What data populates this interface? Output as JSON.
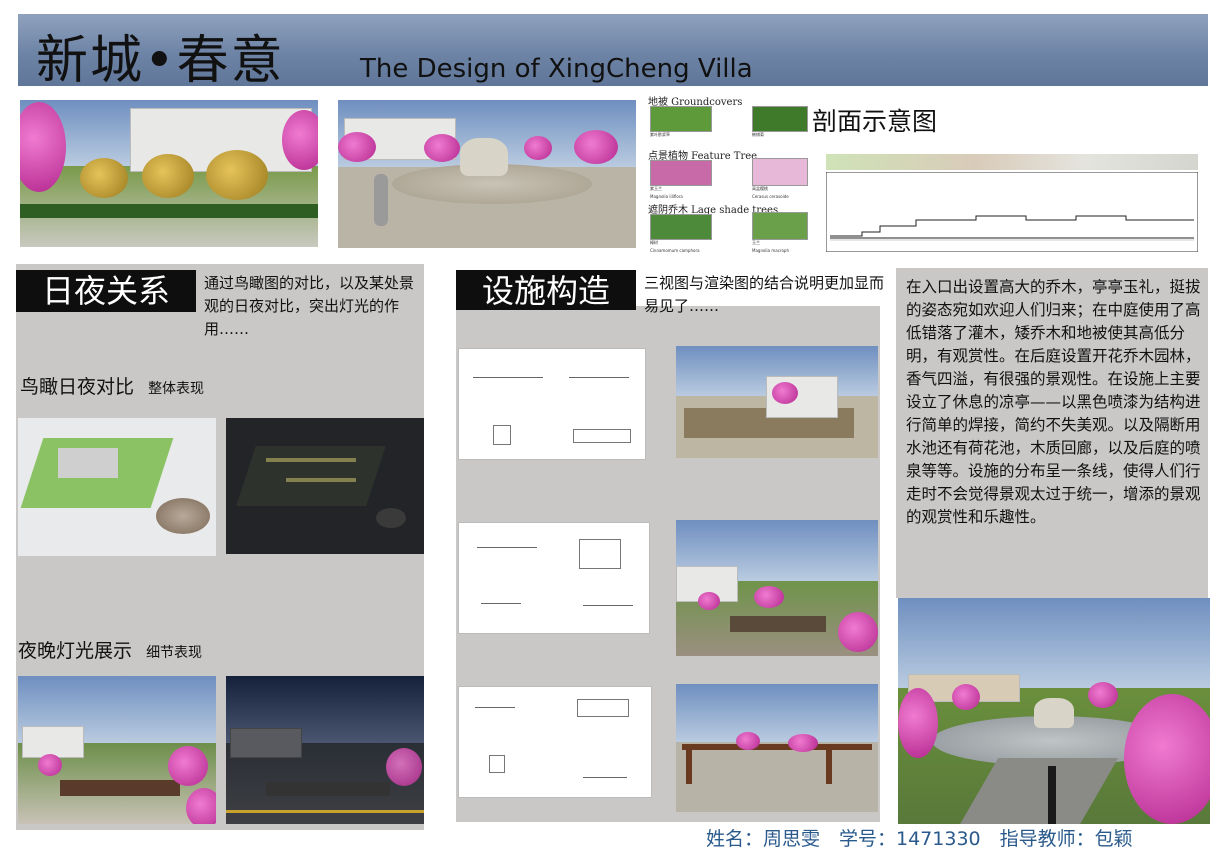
{
  "header": {
    "title_cn": "新城•春意",
    "title_en": "The Design of XingCheng Villa"
  },
  "plants": {
    "groundcovers_title": "地被 Groundcovers",
    "groundcover_1": "紫叶酢浆草",
    "groundcover_2": "蟛蜞菊",
    "feature_tree_title": "点景植物 Feature Tree",
    "feature_1_cn": "紫玉兰",
    "feature_1_en": "Magnolia liliflora",
    "feature_2_cn": "高盆樱桃",
    "feature_2_en": "Cerasus cerasoide",
    "shade_title": "遮阴乔木 Lage shade trees",
    "shade_1_cn": "樟树",
    "shade_1_en": "Cinnamomum camphora",
    "shade_2_cn": "玉兰",
    "shade_2_en": "Magnolia macroph"
  },
  "section": {
    "title": "剖面示意图"
  },
  "day_night": {
    "tag": "日夜关系",
    "desc": "通过鸟瞰图的对比，以及某处景观的日夜对比，突出灯光的作用……",
    "aerial_heading": "鸟瞰日夜对比",
    "aerial_sub": "整体表现",
    "night_heading": "夜晚灯光展示",
    "night_sub": "细节表现"
  },
  "facilities": {
    "tag": "设施构造",
    "desc": "三视图与渲染图的结合说明更加显而易见了……"
  },
  "body_text": "在入口出设置高大的乔木，亭亭玉礼，挺拔的姿态宛如欢迎人们归来；在中庭使用了高低错落了灌木，矮乔木和地被使其高低分明，有观赏性。在后庭设置开花乔木园林，香气四溢，有很强的景观性。在设施上主要设立了休息的凉亭——以黑色喷漆为结构进行简单的焊接，简约不失美观。以及隔断用水池还有荷花池，木质回廊，以及后庭的喷泉等等。设施的分布呈一条线，使得人们行走时不会觉得景观太过于统一，增添的景观的观赏性和乐趣性。",
  "footer": "姓名：周思雯　学号：1471330　指导教师：包颖",
  "colors": {
    "header_band": "#6e84a6",
    "tag_bg": "#0e0e0e",
    "panel_grey": "#c9c8c6",
    "footer_text": "#2a5a8c"
  }
}
